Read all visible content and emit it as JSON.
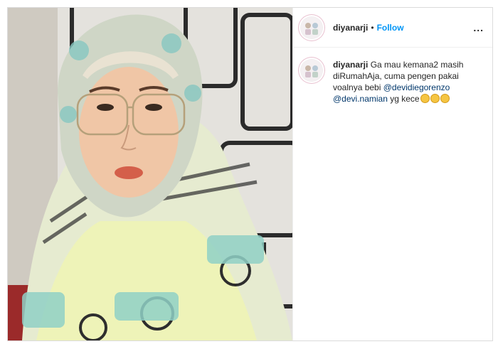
{
  "post": {
    "photo_alt": "Photo",
    "header": {
      "username": "diyanarji",
      "separator": "•",
      "follow_label": "Follow",
      "more_label": "..."
    },
    "caption": {
      "username": "diyanarji",
      "text_part1": "Ga mau kemana2 masih diRumahAja, cuma pengen pakai voalnya bebi",
      "mention1": "@devidiegorenzo",
      "mention2": "@devi.namian",
      "text_part2": "yg kece",
      "emoji_icon": "smiling-face-icon"
    }
  },
  "colors": {
    "follow": "#0095f6",
    "mention": "#00376b",
    "border": "#dbdbdb"
  }
}
